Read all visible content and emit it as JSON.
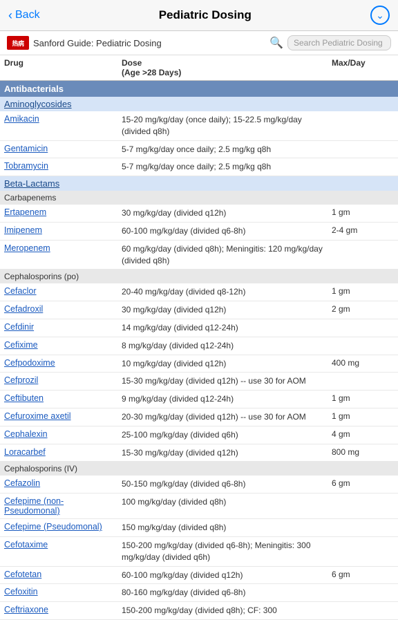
{
  "nav": {
    "back_label": "Back",
    "title": "Pediatric Dosing",
    "circle_icon": "⌄"
  },
  "subheader": {
    "logo_text": "热病",
    "subtitle": "Sanford Guide: Pediatric Dosing",
    "search_placeholder": "Search Pediatric Dosing"
  },
  "columns": {
    "col1": "Drug",
    "col2_line1": "Dose",
    "col2_line2": "(Age >28 Days)",
    "col3": "Max/Day"
  },
  "sections": [
    {
      "type": "section",
      "label": "Antibacterials"
    },
    {
      "type": "subsection",
      "label": "Aminoglycosides"
    },
    {
      "type": "drug",
      "name": "Amikacin",
      "dose": "15-20 mg/kg/day (once daily); 15-22.5 mg/kg/day (divided q8h)",
      "max": ""
    },
    {
      "type": "drug",
      "name": "Gentamicin",
      "dose": "5-7 mg/kg/day once daily; 2.5 mg/kg q8h",
      "max": ""
    },
    {
      "type": "drug",
      "name": "Tobramycin",
      "dose": "5-7 mg/kg/day once daily; 2.5 mg/kg q8h",
      "max": ""
    },
    {
      "type": "subsection",
      "label": "Beta-Lactams"
    },
    {
      "type": "subcategory",
      "label": "Carbapenems"
    },
    {
      "type": "drug",
      "name": "Ertapenem",
      "dose": "30 mg/kg/day (divided q12h)",
      "max": "1 gm"
    },
    {
      "type": "drug",
      "name": "Imipenem",
      "dose": "60-100 mg/kg/day (divided q6-8h)",
      "max": "2-4 gm"
    },
    {
      "type": "drug",
      "name": "Meropenem",
      "dose": "60 mg/kg/day (divided q8h); Meningitis: 120 mg/kg/day (divided q8h)",
      "max": ""
    },
    {
      "type": "subcategory",
      "label": "Cephalosporins (po)"
    },
    {
      "type": "drug",
      "name": "Cefaclor",
      "dose": "20-40 mg/kg/day (divided q8-12h)",
      "max": "1 gm"
    },
    {
      "type": "drug",
      "name": "Cefadroxil",
      "dose": "30 mg/kg/day (divided q12h)",
      "max": "2 gm"
    },
    {
      "type": "drug",
      "name": "Cefdinir",
      "dose": "14 mg/kg/day (divided q12-24h)",
      "max": ""
    },
    {
      "type": "drug",
      "name": "Cefixime",
      "dose": "8 mg/kg/day (divided q12-24h)",
      "max": ""
    },
    {
      "type": "drug",
      "name": "Cefpodoxime",
      "dose": "10 mg/kg/day (divided q12h)",
      "max": "400 mg"
    },
    {
      "type": "drug",
      "name": "Cefprozil",
      "dose": "15-30 mg/kg/day (divided q12h) -- use 30 for AOM",
      "max": ""
    },
    {
      "type": "drug",
      "name": "Ceftibuten",
      "dose": "9 mg/kg/day (divided q12-24h)",
      "max": "1 gm"
    },
    {
      "type": "drug",
      "name": "Cefuroxime axetil",
      "dose": "20-30 mg/kg/day (divided q12h) -- use 30 for AOM",
      "max": "1 gm"
    },
    {
      "type": "drug",
      "name": "Cephalexin",
      "dose": "25-100 mg/kg/day (divided q6h)",
      "max": "4 gm"
    },
    {
      "type": "drug",
      "name": "Loracarbef",
      "dose": "15-30 mg/kg/day (divided q12h)",
      "max": "800 mg"
    },
    {
      "type": "subcategory",
      "label": "Cephalosporins (IV)"
    },
    {
      "type": "drug",
      "name": "Cefazolin",
      "dose": "50-150 mg/kg/day (divided q6-8h)",
      "max": "6 gm"
    },
    {
      "type": "drug",
      "name": "Cefepime (non-Pseudomonal)",
      "dose": "100 mg/kg/day (divided q8h)",
      "max": ""
    },
    {
      "type": "drug",
      "name": "Cefepime (Pseudomonal)",
      "dose": "150 mg/kg/day (divided q8h)",
      "max": ""
    },
    {
      "type": "drug",
      "name": "Cefotaxime",
      "dose": "150-200 mg/kg/day (divided q6-8h); Meningitis: 300 mg/kg/day (divided q6h)",
      "max": ""
    },
    {
      "type": "drug",
      "name": "Cefotetan",
      "dose": "60-100 mg/kg/day (divided q12h)",
      "max": "6 gm"
    },
    {
      "type": "drug",
      "name": "Cefoxitin",
      "dose": "80-160 mg/kg/day (divided q6-8h)",
      "max": ""
    },
    {
      "type": "drug",
      "name": "Ceftriaxone",
      "dose": "150-200 mg/kg/day (divided q8h); CF: 300",
      "max": ""
    }
  ]
}
